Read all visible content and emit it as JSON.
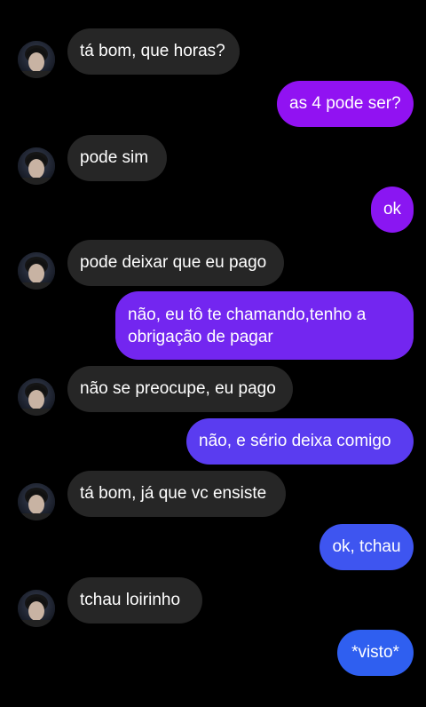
{
  "colors": {
    "background": "#000000",
    "incoming_bubble": "#262626",
    "outgoing_top": "#9112f2",
    "outgoing_mid": "#6a2ff0",
    "outgoing_bottom": "#2f5ff0",
    "text": "#ffffff"
  },
  "messages": [
    {
      "from": "them",
      "text": "tá bom, que horas?"
    },
    {
      "from": "me",
      "text": "as 4 pode ser?"
    },
    {
      "from": "them",
      "text": "pode sim"
    },
    {
      "from": "me",
      "text": "ok"
    },
    {
      "from": "them",
      "text": "pode deixar que eu pago"
    },
    {
      "from": "me",
      "text_lines": [
        "não, eu tô te chamando,tenho a",
        "obrigação de pagar"
      ]
    },
    {
      "from": "them",
      "text": "não se preocupe, eu pago"
    },
    {
      "from": "me",
      "text": "não, e sério deixa comigo"
    },
    {
      "from": "them",
      "text": "tá bom, já que vc ensiste"
    },
    {
      "from": "me",
      "text": "ok, tchau"
    },
    {
      "from": "them",
      "text": "tchau loirinho"
    },
    {
      "from": "me",
      "text": "*visto*"
    }
  ]
}
